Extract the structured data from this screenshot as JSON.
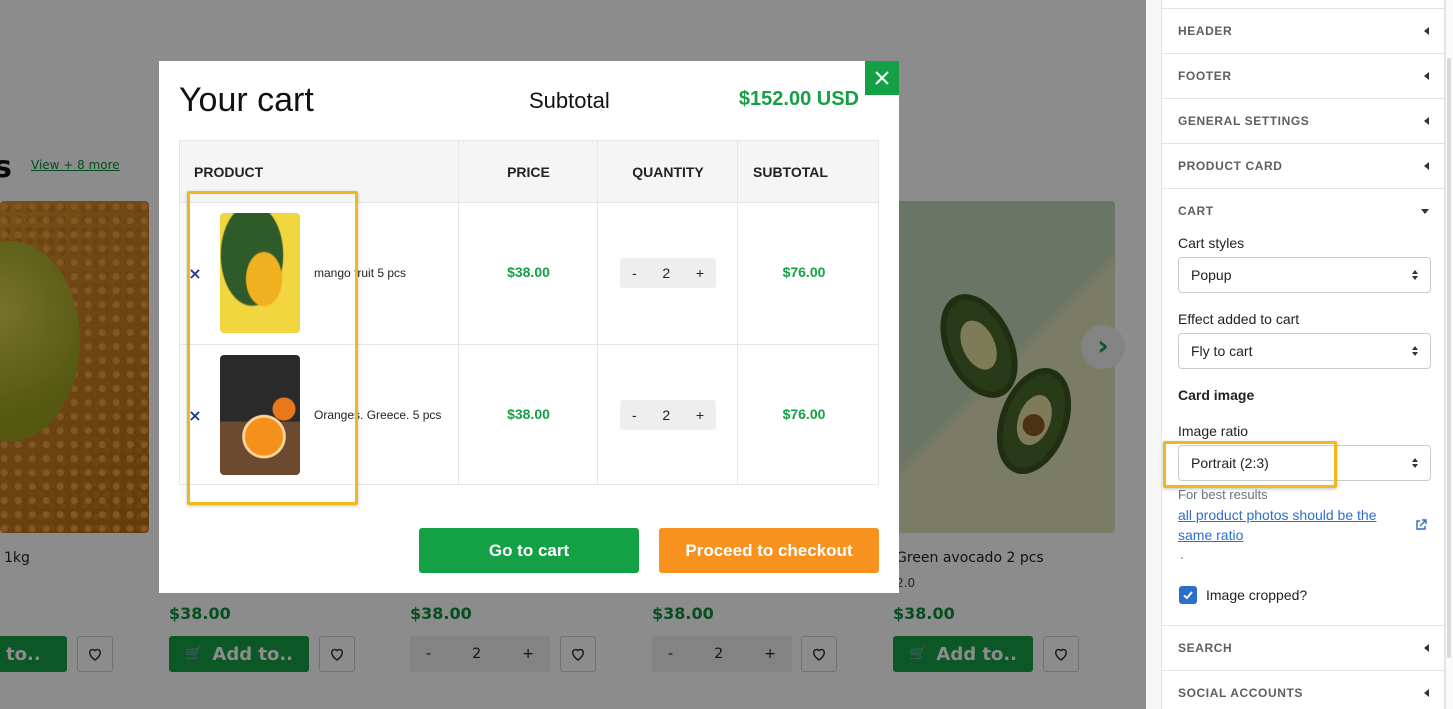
{
  "store": {
    "section_heading_fragment": "s",
    "view_more": "View + 8 more",
    "next_arrow": "›",
    "products": [
      {
        "title": "1kg",
        "subprice": "",
        "price": "",
        "action": "add",
        "add_label": "ld to.."
      },
      {
        "title": "",
        "subprice": "",
        "price": "$38.00",
        "action": "add",
        "add_label": "Add to.."
      },
      {
        "title": "",
        "subprice": "",
        "price": "$38.00",
        "action": "qty",
        "qty": "2"
      },
      {
        "title": "",
        "subprice": "",
        "price": "$38.00",
        "action": "qty",
        "qty": "2"
      },
      {
        "title": "Green avocado 2 pcs",
        "subprice": "2.0",
        "price": "$38.00",
        "action": "add",
        "add_label": "Add to.."
      }
    ],
    "qty_minus": "-",
    "qty_plus": "+"
  },
  "cart": {
    "title": "Your cart",
    "subtotal_label": "Subtotal",
    "subtotal_value": "$152.00 USD",
    "columns": [
      "PRODUCT",
      "PRICE",
      "QUANTITY",
      "SUBTOTAL"
    ],
    "items": [
      {
        "name": "mango fruit 5 pcs",
        "price": "$38.00",
        "qty": "2",
        "subtotal": "$76.00",
        "image": "mango-image"
      },
      {
        "name": "Oranges. Greece. 5 pcs",
        "price": "$38.00",
        "qty": "2",
        "subtotal": "$76.00",
        "image": "oranges-image"
      }
    ],
    "remove_glyph": "×",
    "qty_minus": "-",
    "qty_plus": "+",
    "go_to_cart": "Go to cart",
    "checkout": "Proceed to checkout"
  },
  "settings": {
    "sections_top": [
      "HEADER",
      "FOOTER",
      "GENERAL SETTINGS",
      "PRODUCT CARD"
    ],
    "cart_section": "CART",
    "cart_styles_label": "Cart styles",
    "cart_styles_value": "Popup",
    "effect_label": "Effect added to cart",
    "effect_value": "Fly to cart",
    "card_image_heading": "Card image",
    "image_ratio_label": "Image ratio",
    "image_ratio_value": "Portrait (2:3)",
    "help_text": "For best results",
    "help_link": "all product photos should be the same ratio",
    "help_dot": ".",
    "image_cropped_label": "Image cropped?",
    "image_cropped_checked": true,
    "sections_bottom": [
      "SEARCH",
      "SOCIAL ACCOUNTS"
    ]
  },
  "colors": {
    "accent_green": "#14a045",
    "checkout_orange": "#f7921e",
    "highlight_yellow": "#f0b81c",
    "link_blue": "#2c6ecb"
  }
}
